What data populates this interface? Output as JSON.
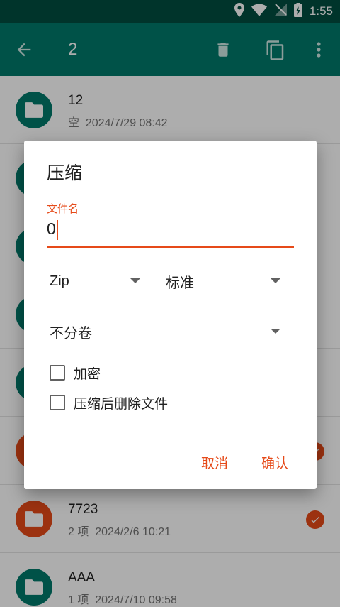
{
  "status_bar": {
    "time": "1:55",
    "icons": [
      "location-icon",
      "wifi-icon",
      "no-signal-icon",
      "battery-charging-icon"
    ]
  },
  "app_bar": {
    "title": "2",
    "icons": [
      "back-arrow-icon",
      "delete-icon",
      "copy-icon",
      "more-vert-icon"
    ]
  },
  "files": [
    {
      "name": "12",
      "count": "空",
      "date": "2024/7/29 08:42",
      "selected": false
    },
    {
      "name": "",
      "count": "",
      "date": "",
      "selected": false
    },
    {
      "name": "",
      "count": "",
      "date": "",
      "selected": false
    },
    {
      "name": "",
      "count": "",
      "date": "",
      "selected": false
    },
    {
      "name": "",
      "count": "",
      "date": "",
      "selected": false
    },
    {
      "name": "",
      "count": "",
      "date": "",
      "selected": true
    },
    {
      "name": "7723",
      "count": "2 项",
      "date": "2024/2/6 10:21",
      "selected": true
    },
    {
      "name": "AAA",
      "count": "1 项",
      "date": "2024/7/10 09:58",
      "selected": false
    }
  ],
  "dialog": {
    "title": "压缩",
    "filename_label": "文件名",
    "filename_value": "0",
    "format_value": "Zip",
    "level_value": "标准",
    "split_value": "不分卷",
    "encrypt_label": "加密",
    "delete_after_label": "压缩后删除文件",
    "cancel_label": "取消",
    "ok_label": "确认"
  },
  "colors": {
    "primary": "#00796b",
    "primary_dark": "#004d40",
    "accent": "#e64a19"
  }
}
